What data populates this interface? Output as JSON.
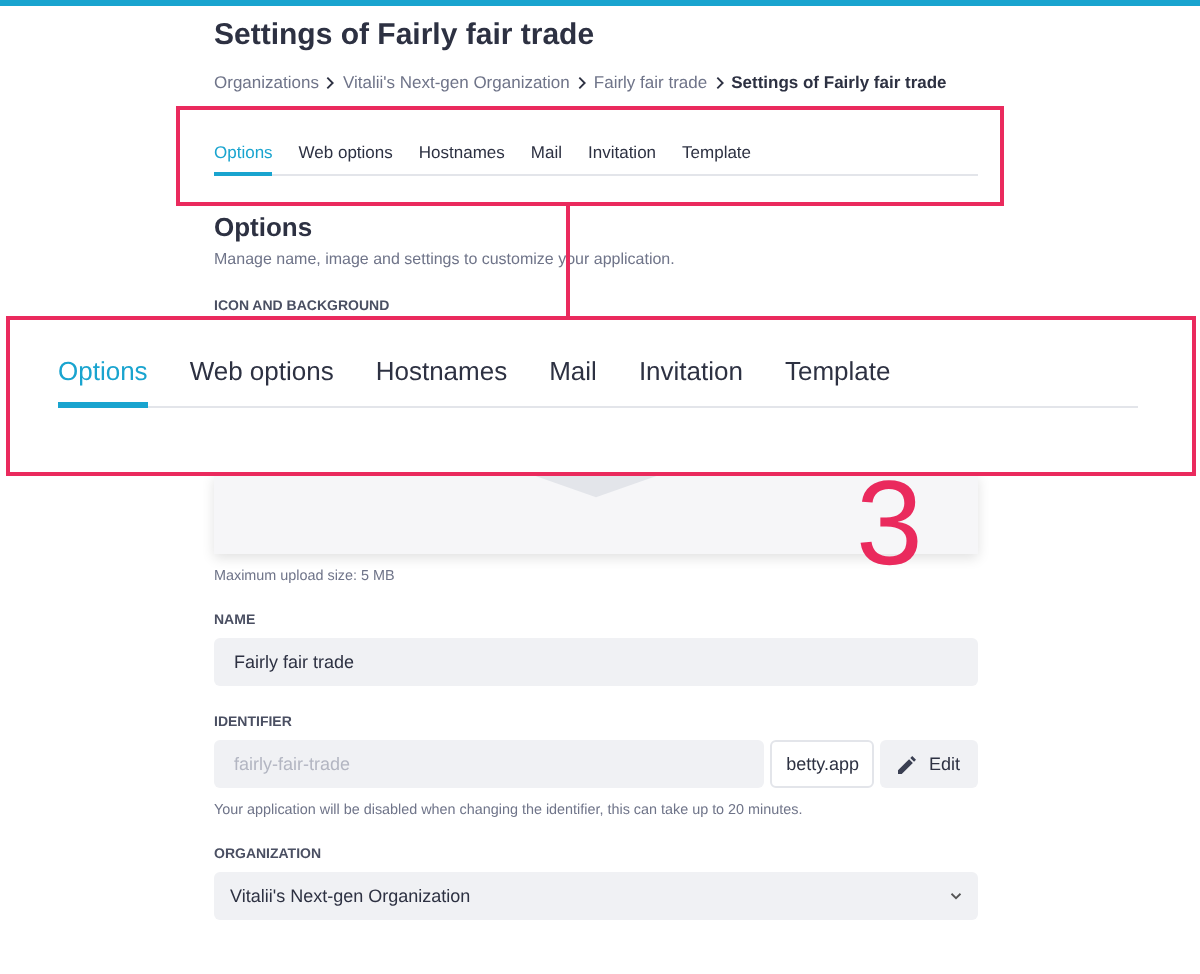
{
  "page": {
    "title": "Settings of Fairly fair trade"
  },
  "breadcrumb": [
    "Organizations",
    "Vitalii's Next-gen Organization",
    "Fairly fair trade",
    "Settings of Fairly fair trade"
  ],
  "tabs": [
    {
      "label": "Options",
      "selected": true
    },
    {
      "label": "Web options",
      "selected": false
    },
    {
      "label": "Hostnames",
      "selected": false
    },
    {
      "label": "Mail",
      "selected": false
    },
    {
      "label": "Invitation",
      "selected": false
    },
    {
      "label": "Template",
      "selected": false
    }
  ],
  "section": {
    "title": "Options",
    "description": "Manage name, image and settings to customize your application."
  },
  "icon_and_background": {
    "label": "ICON AND BACKGROUND",
    "hint": "Maximum upload size: 5 MB"
  },
  "name": {
    "label": "NAME",
    "value": "Fairly fair trade"
  },
  "identifier": {
    "label": "IDENTIFIER",
    "placeholder": "fairly-fair-trade",
    "suffix": "betty.app",
    "button": "Edit",
    "help": "Your application will be disabled when changing the identifier, this can take up to 20 minutes."
  },
  "organization": {
    "label": "ORGANIZATION",
    "value": "Vitalii's Next-gen Organization"
  },
  "callout": {
    "number": "3",
    "tabs": [
      {
        "label": "Options",
        "selected": true
      },
      {
        "label": "Web options",
        "selected": false
      },
      {
        "label": "Hostnames",
        "selected": false
      },
      {
        "label": "Mail",
        "selected": false
      },
      {
        "label": "Invitation",
        "selected": false
      },
      {
        "label": "Template",
        "selected": false
      }
    ]
  }
}
